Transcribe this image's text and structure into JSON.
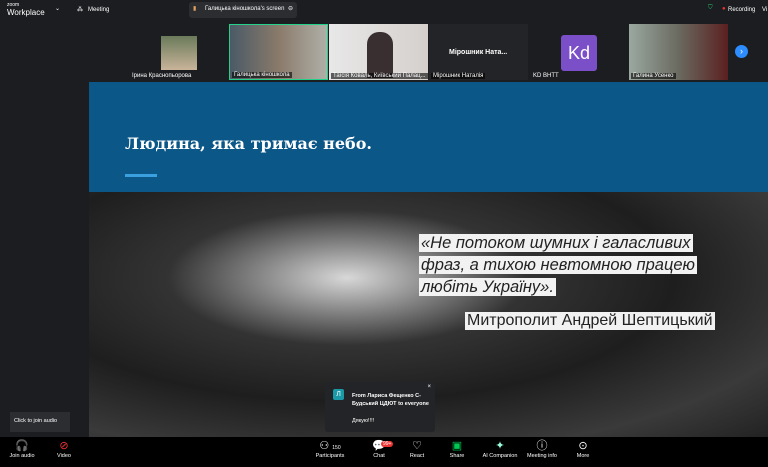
{
  "topbar": {
    "logo_small": "zoom",
    "logo_big": "Workplace",
    "meeting": "Meeting",
    "share_tab": "Галицька кіношкола's screen",
    "recording": "Recording",
    "more_cut": "Vi"
  },
  "participants": [
    {
      "name": "Ірина Краснопьорова"
    },
    {
      "name": "Галицька кіношкола"
    },
    {
      "name": "Таїсія Коваль, Київський Палац..."
    },
    {
      "name": "Мірошник Наталія",
      "display": "Мірошник  Ната..."
    },
    {
      "name": "KD ВНТТ",
      "initials": "Kd"
    },
    {
      "name": "Галина Усенко"
    }
  ],
  "slide": {
    "title": "Людина, яка тримає небо.",
    "quote_lines": [
      "«Не потоком шумних і галасливих",
      "фраз, а тихою невтомною працею",
      "любіть Україну»."
    ],
    "author": "Митрополит Андрей Шептицький"
  },
  "chat_popup": {
    "avatar": "Л",
    "from": "From Лариса Фещенко С-Будський ЦДЮТ to everyone",
    "message": "Дякую!!!!"
  },
  "tooltip": "Click to join audio",
  "toolbar": {
    "join_audio": "Join audio",
    "video": "Video",
    "participants": "Participants",
    "participant_count": "150",
    "chat": "Chat",
    "chat_badge": "99+",
    "react": "React",
    "share": "Share",
    "ai": "AI Companion",
    "info": "Meeting info",
    "more": "More"
  },
  "colors": {
    "slide_header": "#0b5788",
    "accent": "#3aa0e0",
    "active_speaker": "#23d18b",
    "share_green": "#00c853",
    "kd": "#7b4fc8"
  }
}
